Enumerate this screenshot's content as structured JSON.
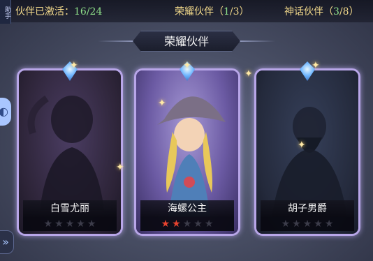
{
  "side_tag": "助手",
  "stats": {
    "activated": {
      "label": "伙伴已激活：",
      "current": "16",
      "sep": "/",
      "total": "24"
    },
    "glory": {
      "label": "荣耀伙伴",
      "open": "（",
      "current": "1",
      "sep": "/",
      "total": "3",
      "close": "）"
    },
    "myth": {
      "label": "神话伙伴",
      "open": "（",
      "current": "3",
      "sep": "/",
      "total": "8",
      "close": "）"
    }
  },
  "section_title": "荣耀伙伴",
  "cards": [
    {
      "name": "白雪尤丽",
      "stars_total": 5,
      "stars_filled": 0,
      "unlocked": false
    },
    {
      "name": "海螺公主",
      "stars_total": 5,
      "stars_filled": 2,
      "unlocked": true
    },
    {
      "name": "胡子男爵",
      "stars_total": 5,
      "stars_filled": 0,
      "unlocked": false
    }
  ],
  "icons": {
    "left_button": "chat-icon",
    "left_arrow": "double-chevron-icon",
    "card_gem": "gem-icon",
    "star": "star-icon"
  },
  "colors": {
    "star_on": "#e8432f",
    "star_off": "#3c3c4a",
    "stat_number": "#8fe08a",
    "stat_label": "#f0d78a"
  }
}
